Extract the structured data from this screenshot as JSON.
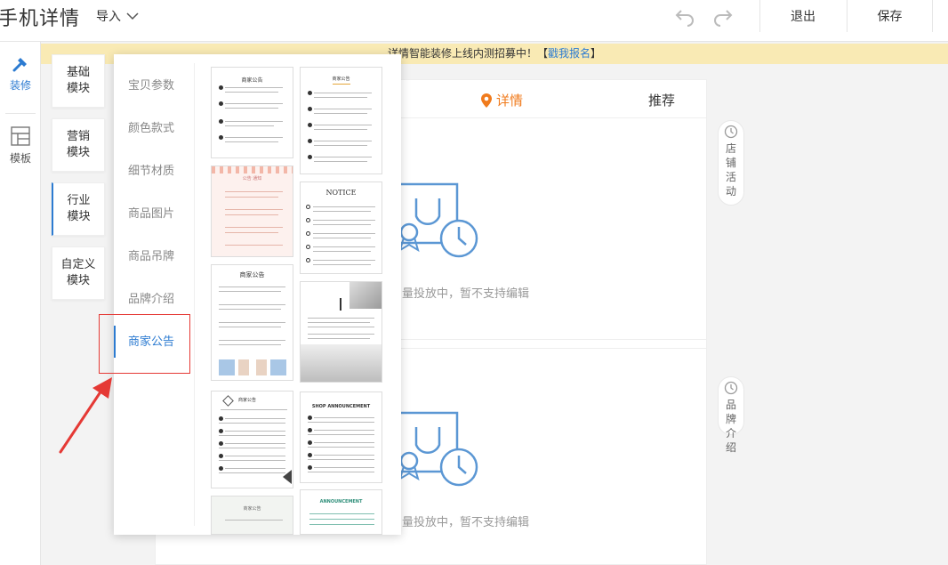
{
  "app": {
    "title": "手机详情",
    "import_label": "导入"
  },
  "toolbar": {
    "logout": "退出",
    "save": "保存"
  },
  "leftnav": [
    {
      "label": "装修",
      "icon": "hammer-icon",
      "active": true
    },
    {
      "label": "模板",
      "icon": "template-icon",
      "active": false
    }
  ],
  "banner": {
    "text": "详情智能装修上线内测招募中！【",
    "link": "戳我报名",
    "end": "】"
  },
  "module_tabs": [
    "基础\n模块",
    "营销\n模块",
    "行业\n模块",
    "自定义\n模块"
  ],
  "categories": [
    "宝贝参数",
    "颜色款式",
    "细节材质",
    "商品图片",
    "商品吊牌",
    "品牌介绍",
    "商家公告"
  ],
  "phone": {
    "tab_detail": "详情",
    "tab_recommend": "推荐"
  },
  "blocks": [
    {
      "msg": "量投放中，暂不支持编辑"
    },
    {
      "msg": "量投放中，暂不支持编辑"
    }
  ],
  "side_pills": [
    {
      "label": "店铺活动"
    },
    {
      "label": "品牌介绍"
    }
  ],
  "thumbs": [
    {
      "title": "商家公告"
    },
    {
      "title": "商家公告"
    },
    {
      "title": "公告 通知"
    },
    {
      "title": "NOTICE"
    },
    {
      "title": "商家公告"
    },
    {
      "title": ""
    },
    {
      "title": "商家公告"
    },
    {
      "title": "SHOP ANNOUNCEMENT"
    },
    {
      "title": "商家公告"
    },
    {
      "title": "ANNOUNCEMENT"
    }
  ],
  "colors": {
    "accent": "#2c7bd1",
    "orange": "#f07b1d",
    "banner": "#f9eab4",
    "highlight": "#e53935"
  }
}
